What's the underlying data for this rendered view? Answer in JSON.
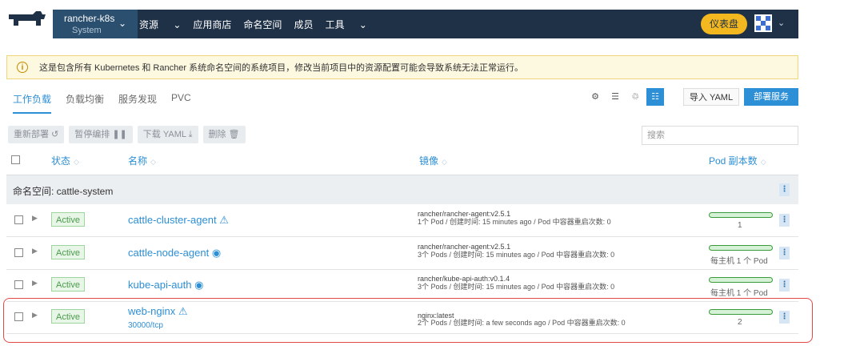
{
  "header": {
    "cluster_name": "rancher-k8s",
    "project_name": "System",
    "menu": [
      "资源",
      "应用商店",
      "命名空间",
      "成员",
      "工具"
    ],
    "dashboard_label": "仪表盘"
  },
  "banner": {
    "text": "这是包含所有 Kubernetes 和 Rancher 系统命名空间的系统项目，修改当前项目中的资源配置可能会导致系统无法正常运行。"
  },
  "tabs": [
    "工作负载",
    "负载均衡",
    "服务发现",
    "PVC"
  ],
  "toolbar": {
    "import_label": "导入 YAML",
    "deploy_label": "部署服务"
  },
  "bulk_actions": {
    "redeploy": "重新部署 ↺",
    "pause": "暂停编排 ❚❚",
    "download": "下载 YAML ⤓",
    "delete": "删除 🗑"
  },
  "search": {
    "placeholder": "搜索"
  },
  "columns": {
    "status": "状态",
    "name": "名称",
    "image": "镜像",
    "pods": "Pod 副本数"
  },
  "group": {
    "label": "命名空间: cattle-system"
  },
  "workloads": [
    {
      "status": "Active",
      "name": "cattle-cluster-agent",
      "name_icon": "⚠",
      "subtitle": "",
      "image": "rancher/rancher-agent:v2.5.1",
      "image_meta": "1个 Pod / 创建时间: 15 minutes ago / Pod 中容器重启次数: 0",
      "pod_text": "1",
      "fill": 1.0
    },
    {
      "status": "Active",
      "name": "cattle-node-agent",
      "name_icon": "◉",
      "subtitle": "",
      "image": "rancher/rancher-agent:v2.5.1",
      "image_meta": "3个 Pods / 创建时间: 15 minutes ago / Pod 中容器重启次数: 0",
      "pod_text": "每主机 1 个 Pod",
      "fill": 1.0
    },
    {
      "status": "Active",
      "name": "kube-api-auth",
      "name_icon": "◉",
      "subtitle": "",
      "image": "rancher/kube-api-auth:v0.1.4",
      "image_meta": "3个 Pods / 创建时间: 15 minutes ago / Pod 中容器重启次数: 0",
      "pod_text": "每主机 1 个 Pod",
      "fill": 1.0
    },
    {
      "status": "Active",
      "name": "web-nginx",
      "name_icon": "⚠",
      "subtitle": "30000/tcp",
      "image": "nginx:latest",
      "image_meta": "2个 Pods / 创建时间: a few seconds ago / Pod 中容器重启次数: 0",
      "pod_text": "2",
      "fill": 1.0
    }
  ],
  "colors": {
    "nav": "#1f3147",
    "accent": "#2d8fd5",
    "warning": "#f3b720",
    "active_green": "#4b9a4b",
    "highlight": "#e24a4a"
  }
}
